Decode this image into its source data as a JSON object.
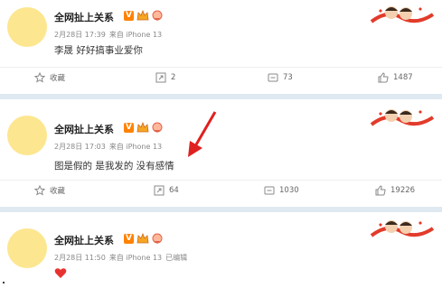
{
  "posts": [
    {
      "author": "全网扯上关系",
      "date": "2月28日 17:39",
      "source": "来自 iPhone 13",
      "edited": "",
      "content": "李晟 好好搞事业爱你",
      "actions": {
        "favorite": "收藏",
        "repost": "2",
        "comment": "73",
        "like": "1487"
      }
    },
    {
      "author": "全网扯上关系",
      "date": "2月28日 17:03",
      "source": "来自 iPhone 13",
      "edited": "",
      "content": "图是假的 是我发的 没有感情",
      "actions": {
        "favorite": "收藏",
        "repost": "64",
        "comment": "1030",
        "like": "19226"
      }
    },
    {
      "author": "全网扯上关系",
      "date": "2月28日 11:50",
      "source": "来自 iPhone 13",
      "edited": "已编辑",
      "content": "",
      "actions": {}
    }
  ],
  "icons": [
    "verified-v-icon",
    "vip-crown-icon",
    "fan-badge-icon",
    "star-icon",
    "repost-icon",
    "comment-icon",
    "thumb-up-icon",
    "red-heart-emoji",
    "red-arrow-annotation",
    "cartoon-couple-decoration"
  ],
  "colors": {
    "avatar": "#fde690",
    "separator": "#dfe9f2",
    "vbadge": "#ff8200",
    "arrow": "#e0201f",
    "heart": "#e8322f"
  }
}
